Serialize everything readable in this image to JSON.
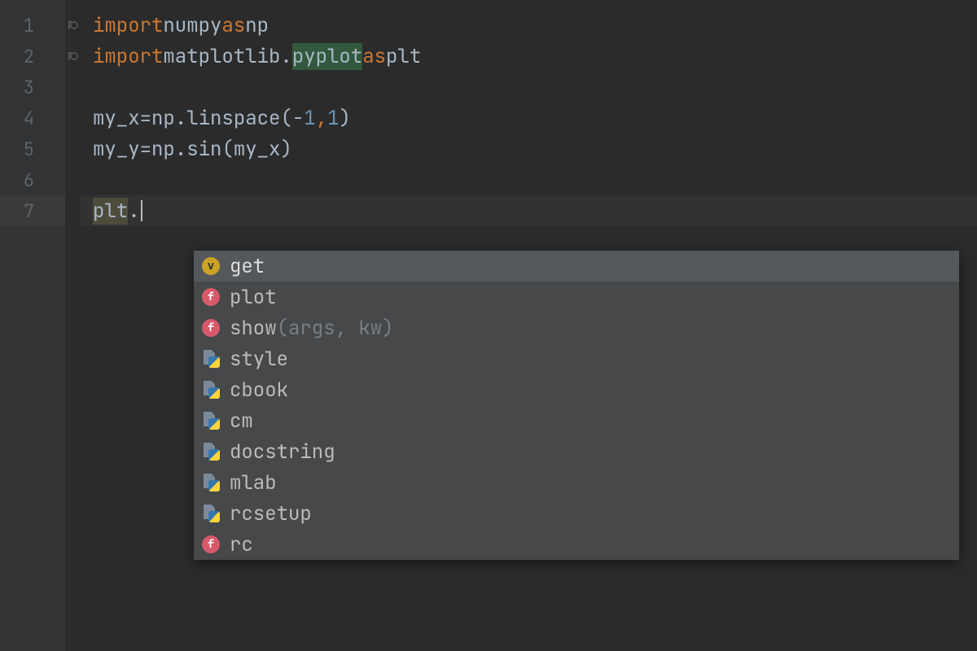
{
  "gutter": {
    "lines": [
      "1",
      "2",
      "3",
      "4",
      "5",
      "6",
      "7"
    ],
    "current": 7
  },
  "code": {
    "lines": [
      {
        "tokens": [
          [
            "kw",
            "import"
          ],
          [
            "sp",
            " "
          ],
          [
            "id",
            "numpy"
          ],
          [
            "sp",
            " "
          ],
          [
            "kw",
            "as"
          ],
          [
            "sp",
            " "
          ],
          [
            "id",
            "np"
          ]
        ]
      },
      {
        "tokens": [
          [
            "kw",
            "import"
          ],
          [
            "sp",
            " "
          ],
          [
            "id",
            "matplotlib"
          ],
          [
            "op",
            "."
          ],
          [
            "hl-pyplot",
            "pyplot"
          ],
          [
            "sp",
            " "
          ],
          [
            "kw",
            "as"
          ],
          [
            "sp",
            " "
          ],
          [
            "id",
            "plt"
          ]
        ]
      },
      {
        "tokens": []
      },
      {
        "tokens": [
          [
            "id",
            "my_x"
          ],
          [
            "sp",
            " "
          ],
          [
            "op",
            "="
          ],
          [
            "sp",
            " "
          ],
          [
            "id",
            "np"
          ],
          [
            "op",
            "."
          ],
          [
            "func",
            "linspace"
          ],
          [
            "op",
            "("
          ],
          [
            "op",
            "-"
          ],
          [
            "num",
            "1"
          ],
          [
            "comma",
            ","
          ],
          [
            "sp",
            " "
          ],
          [
            "num",
            "1"
          ],
          [
            "op",
            ")"
          ]
        ]
      },
      {
        "tokens": [
          [
            "id",
            "my_y"
          ],
          [
            "sp",
            " "
          ],
          [
            "op",
            "="
          ],
          [
            "sp",
            " "
          ],
          [
            "id",
            "np"
          ],
          [
            "op",
            "."
          ],
          [
            "func",
            "sin"
          ],
          [
            "op",
            "("
          ],
          [
            "id",
            "my_x"
          ],
          [
            "op",
            ")"
          ]
        ]
      },
      {
        "tokens": []
      },
      {
        "tokens": [
          [
            "hl-plt",
            "plt"
          ],
          [
            "op",
            "."
          ],
          [
            "caret",
            ""
          ]
        ],
        "current": true
      }
    ]
  },
  "popup": {
    "items": [
      {
        "kind": "v",
        "label": "get",
        "selected": true
      },
      {
        "kind": "f",
        "label": "plot"
      },
      {
        "kind": "f",
        "label": "show",
        "params": "(args, kw)"
      },
      {
        "kind": "m",
        "label": "style"
      },
      {
        "kind": "m",
        "label": "cbook"
      },
      {
        "kind": "m",
        "label": "cm"
      },
      {
        "kind": "m",
        "label": "docstring"
      },
      {
        "kind": "m",
        "label": "mlab"
      },
      {
        "kind": "m",
        "label": "rcsetup"
      },
      {
        "kind": "f",
        "label": "rc"
      }
    ]
  }
}
